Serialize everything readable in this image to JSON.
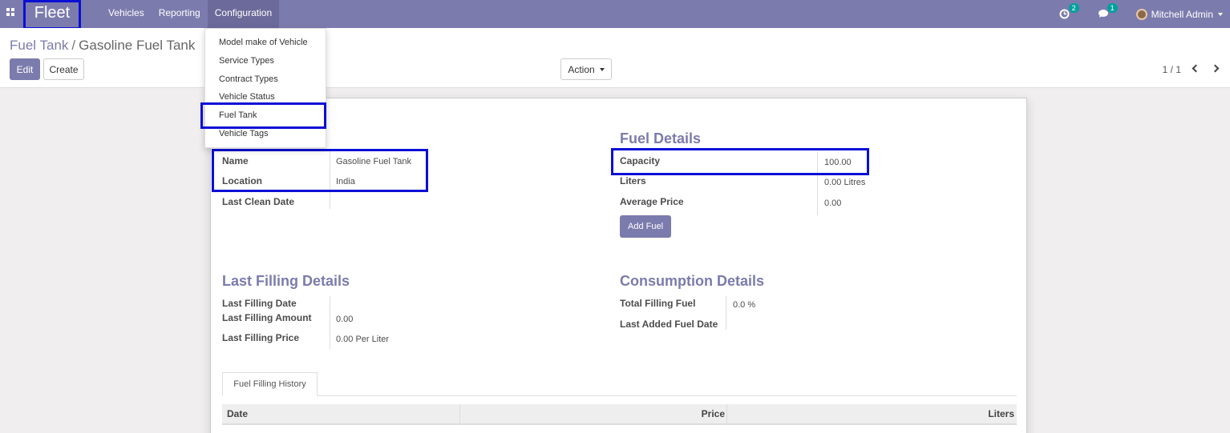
{
  "app": {
    "brand": "Fleet"
  },
  "nav": {
    "items": [
      "Vehicles",
      "Reporting",
      "Configuration"
    ],
    "activity_count": "2",
    "messages_count": "1",
    "user_name": "Mitchell Admin"
  },
  "dropdown": {
    "items": [
      "Model make of Vehicle",
      "Service Types",
      "Contract Types",
      "Vehicle Status",
      "Fuel Tank",
      "Vehicle Tags"
    ]
  },
  "breadcrumb": {
    "parent": "Fuel Tank",
    "separator": "/",
    "current": "Gasoline Fuel Tank"
  },
  "buttons": {
    "edit": "Edit",
    "create": "Create",
    "action": "Action",
    "add_fuel": "Add Fuel"
  },
  "pager": {
    "value": "1 / 1"
  },
  "form": {
    "general": {
      "name_label": "Name",
      "name_value": "Gasoline Fuel Tank",
      "location_label": "Location",
      "location_value": "India",
      "clean_label": "Last Clean Date",
      "clean_value": ""
    },
    "fuel_details": {
      "title": "Fuel Details",
      "capacity_label": "Capacity",
      "capacity_value": "100.00",
      "liters_label": "Liters",
      "liters_value": "0.00 Litres",
      "avg_label": "Average Price",
      "avg_value": "0.00"
    },
    "last_filling": {
      "title": "Last Filling Details",
      "date_label": "Last Filling Date",
      "date_value": "",
      "amount_label": "Last Filling Amount",
      "amount_value": "0.00",
      "price_label": "Last Filling Price",
      "price_value": "0.00 Per Liter"
    },
    "consumption": {
      "title": "Consumption Details",
      "total_label": "Total Filling Fuel",
      "total_value": "0.0 %",
      "last_added_label": "Last Added Fuel Date",
      "last_added_value": ""
    }
  },
  "tabs": {
    "history": "Fuel Filling History"
  },
  "table": {
    "headers": [
      "Date",
      "Price",
      "Liters"
    ]
  },
  "colors": {
    "navbar": "#7c7bad",
    "highlight": "#0b0fd6",
    "accent": "#7c7bad"
  }
}
